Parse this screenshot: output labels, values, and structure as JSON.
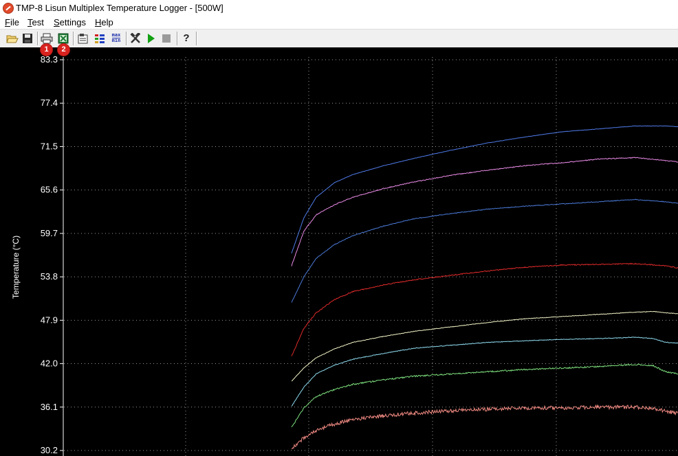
{
  "window": {
    "title": "TMP-8 Lisun Multiplex Temperature Logger - [500W]"
  },
  "menu": {
    "items": [
      "File",
      "Test",
      "Settings",
      "Help"
    ]
  },
  "toolbar": {
    "buttons": [
      "open-icon",
      "save-icon",
      "print-icon",
      "export-icon",
      "properties-icon",
      "channels-icon",
      "max-min-icon",
      "tools-icon",
      "play-icon",
      "stop-icon",
      "help-icon"
    ],
    "maxmin_top": "max",
    "maxmin_bottom": "min",
    "help_glyph": "?"
  },
  "badges": {
    "one": "1",
    "two": "2"
  },
  "chart_data": {
    "type": "line",
    "ylabel": "Temperature (°C)",
    "yticks": [
      30.2,
      36.1,
      42.0,
      47.9,
      53.8,
      59.7,
      65.6,
      71.5,
      77.4,
      83.3
    ],
    "ylim": [
      30.2,
      83.3
    ],
    "grid": true,
    "grid_style": "dotted",
    "background": "#000000",
    "x_range_sample": [
      0,
      315
    ],
    "series": [
      {
        "color": "#4f7bea",
        "x": [
          0,
          10,
          20,
          35,
          50,
          75,
          100,
          130,
          160,
          190,
          220,
          250,
          280,
          305,
          315
        ],
        "values": [
          57.0,
          61.8,
          64.6,
          66.6,
          67.7,
          68.9,
          69.9,
          71.0,
          72.0,
          72.8,
          73.5,
          73.9,
          74.3,
          74.3,
          74.2
        ]
      },
      {
        "color": "#e98ae6",
        "x": [
          0,
          10,
          20,
          35,
          50,
          75,
          100,
          130,
          160,
          190,
          220,
          250,
          280,
          305,
          315
        ],
        "values": [
          55.3,
          60.0,
          62.2,
          63.6,
          64.6,
          65.8,
          66.7,
          67.6,
          68.3,
          68.9,
          69.3,
          69.8,
          70.0,
          69.6,
          69.4
        ]
      },
      {
        "color": "#4a7ad8",
        "x": [
          0,
          10,
          20,
          35,
          50,
          75,
          100,
          130,
          160,
          190,
          220,
          250,
          280,
          305,
          315
        ],
        "values": [
          50.3,
          53.8,
          56.3,
          58.2,
          59.4,
          60.7,
          61.7,
          62.4,
          63.0,
          63.4,
          63.7,
          64.0,
          64.3,
          64.0,
          63.8
        ]
      },
      {
        "color": "#e02a2a",
        "x": [
          0,
          10,
          20,
          35,
          50,
          75,
          100,
          130,
          160,
          190,
          220,
          250,
          280,
          305,
          315
        ],
        "values": [
          43.0,
          46.8,
          48.9,
          50.7,
          51.8,
          52.7,
          53.4,
          54.0,
          54.6,
          55.1,
          55.4,
          55.5,
          55.6,
          55.3,
          55.0
        ]
      },
      {
        "color": "#f4f4c8",
        "x": [
          0,
          10,
          20,
          35,
          50,
          75,
          100,
          130,
          160,
          190,
          220,
          250,
          280,
          295,
          305,
          315
        ],
        "values": [
          39.6,
          41.4,
          42.8,
          44.0,
          44.9,
          45.7,
          46.4,
          47.0,
          47.6,
          48.1,
          48.4,
          48.7,
          49.0,
          49.1,
          48.9,
          48.8
        ]
      },
      {
        "color": "#8edcf0",
        "x": [
          0,
          10,
          20,
          35,
          50,
          75,
          100,
          130,
          160,
          190,
          220,
          250,
          280,
          295,
          305,
          315
        ],
        "values": [
          36.2,
          38.8,
          40.6,
          41.8,
          42.6,
          43.4,
          44.1,
          44.5,
          44.9,
          45.1,
          45.3,
          45.4,
          45.6,
          45.4,
          44.9,
          44.8
        ]
      },
      {
        "color": "#7ee07e",
        "x": [
          0,
          10,
          20,
          35,
          50,
          75,
          100,
          130,
          160,
          190,
          220,
          250,
          280,
          295,
          305,
          315
        ],
        "values": [
          33.3,
          36.0,
          37.5,
          38.5,
          39.2,
          39.8,
          40.3,
          40.6,
          40.9,
          41.2,
          41.4,
          41.6,
          41.9,
          41.7,
          40.9,
          40.6
        ]
      },
      {
        "color": "#f08a82",
        "x": [
          0,
          10,
          20,
          35,
          50,
          75,
          100,
          130,
          160,
          190,
          220,
          250,
          280,
          295,
          305,
          315
        ],
        "values": [
          30.4,
          31.9,
          32.9,
          33.8,
          34.4,
          34.9,
          35.3,
          35.6,
          35.8,
          36.0,
          36.0,
          36.1,
          36.1,
          35.9,
          35.5,
          35.3
        ]
      }
    ]
  }
}
